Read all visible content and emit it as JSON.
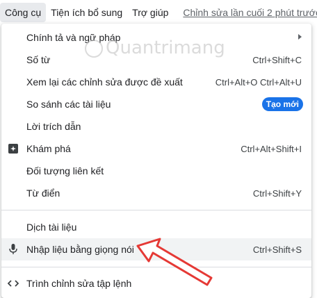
{
  "menubar": {
    "tools": "Công cụ",
    "addons": "Tiện ích bổ sung",
    "help": "Trợ giúp",
    "last_edit": "Chỉnh sửa lần cuối 2 phút trước"
  },
  "dropdown": {
    "items": [
      {
        "label": "Chính tả và ngữ pháp",
        "shortcut": ""
      },
      {
        "label": "Số từ",
        "shortcut": "Ctrl+Shift+C"
      },
      {
        "label": "Xem lại các chỉnh sửa được đề xuất",
        "shortcut": "Ctrl+Alt+O Ctrl+Alt+U"
      },
      {
        "label": "So sánh các tài liệu",
        "badge": "Tạo mới"
      },
      {
        "label": "Lời trích dẫn",
        "shortcut": ""
      },
      {
        "label": "Khám phá",
        "shortcut": "Ctrl+Alt+Shift+I",
        "icon": "explore-plus-icon"
      },
      {
        "label": "Đối tượng liên kết",
        "shortcut": ""
      },
      {
        "label": "Từ điển",
        "shortcut": "Ctrl+Shift+Y"
      },
      {
        "label": "Dịch tài liệu",
        "shortcut": ""
      },
      {
        "label": "Nhập liệu bằng giọng nói",
        "shortcut": "Ctrl+Shift+S",
        "icon": "microphone-icon"
      },
      {
        "label": "Trình chỉnh sửa tập lệnh",
        "shortcut": "",
        "icon": "code-icon"
      }
    ]
  },
  "watermark": "Quantrimang",
  "colors": {
    "accent": "#1a73e8",
    "highlight_arrow": "#e53935",
    "hover": "#f1f3f4"
  }
}
